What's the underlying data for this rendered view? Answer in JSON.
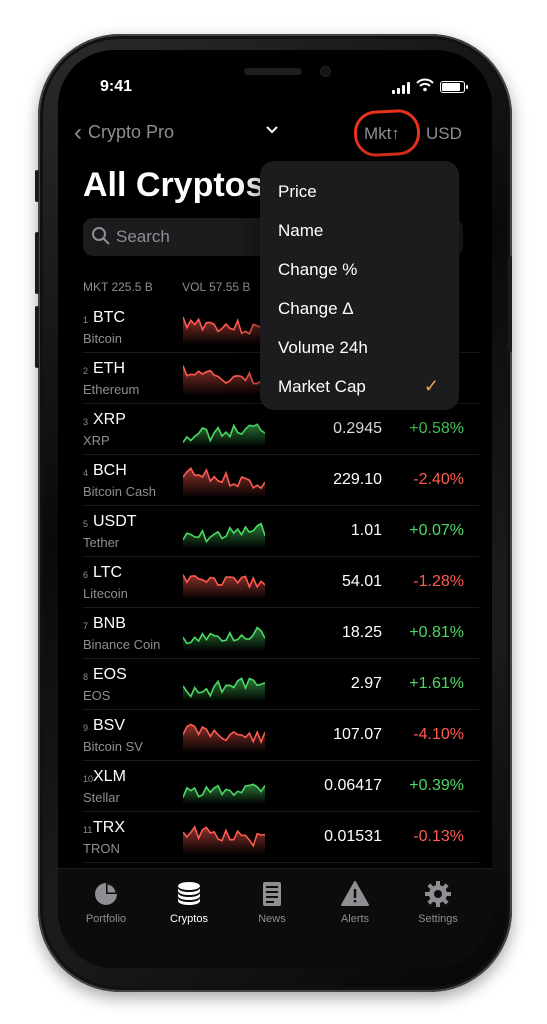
{
  "status": {
    "time": "9:41"
  },
  "nav": {
    "back_label": "Crypto Pro",
    "back_icon": "chevron-left-icon",
    "dropdown_icon": "chevron-down-icon",
    "sort_label": "Mkt↑",
    "currency_label": "USD"
  },
  "page": {
    "title": "All Cryptos"
  },
  "search": {
    "placeholder": "Search"
  },
  "summary": {
    "mkt": "MKT 225.5 B",
    "vol": "VOL 57.55 B"
  },
  "sort_menu": {
    "items": [
      {
        "label": "Price",
        "checked": false
      },
      {
        "label": "Name",
        "checked": false
      },
      {
        "label": "Change %",
        "checked": false
      },
      {
        "label": "Change Δ",
        "checked": false
      },
      {
        "label": "Volume 24h",
        "checked": false
      },
      {
        "label": "Market Cap",
        "checked": true
      }
    ],
    "check_glyph": "✓"
  },
  "coins": [
    {
      "rank": "1",
      "symbol": "BTC",
      "name": "Bitcoin",
      "price": "",
      "change": "",
      "trend": "down"
    },
    {
      "rank": "2",
      "symbol": "ETH",
      "name": "Ethereum",
      "price": "",
      "change": "",
      "trend": "down"
    },
    {
      "rank": "3",
      "symbol": "XRP",
      "name": "XRP",
      "price": "0.2945",
      "change": "+0.58%",
      "trend": "up"
    },
    {
      "rank": "4",
      "symbol": "BCH",
      "name": "Bitcoin Cash",
      "price": "229.10",
      "change": "-2.40%",
      "trend": "down"
    },
    {
      "rank": "5",
      "symbol": "USDT",
      "name": "Tether",
      "price": "1.01",
      "change": "+0.07%",
      "trend": "up"
    },
    {
      "rank": "6",
      "symbol": "LTC",
      "name": "Litecoin",
      "price": "54.01",
      "change": "-1.28%",
      "trend": "down"
    },
    {
      "rank": "7",
      "symbol": "BNB",
      "name": "Binance Coin",
      "price": "18.25",
      "change": "+0.81%",
      "trend": "up"
    },
    {
      "rank": "8",
      "symbol": "EOS",
      "name": "EOS",
      "price": "2.97",
      "change": "+1.61%",
      "trend": "up"
    },
    {
      "rank": "9",
      "symbol": "BSV",
      "name": "Bitcoin SV",
      "price": "107.07",
      "change": "-4.10%",
      "trend": "down"
    },
    {
      "rank": "10",
      "symbol": "XLM",
      "name": "Stellar",
      "price": "0.06417",
      "change": "+0.39%",
      "trend": "up"
    },
    {
      "rank": "11",
      "symbol": "TRX",
      "name": "TRON",
      "price": "0.01531",
      "change": "-0.13%",
      "trend": "down"
    }
  ],
  "tabs": [
    {
      "label": "Portfolio",
      "icon": "pie-chart-icon",
      "active": false
    },
    {
      "label": "Cryptos",
      "icon": "coins-stack-icon",
      "active": true
    },
    {
      "label": "News",
      "icon": "newspaper-icon",
      "active": false
    },
    {
      "label": "Alerts",
      "icon": "alert-triangle-icon",
      "active": false
    },
    {
      "label": "Settings",
      "icon": "gear-icon",
      "active": false
    }
  ],
  "colors": {
    "up": "#4cd964",
    "down": "#ff5b4f",
    "accent": "#f0a24e",
    "highlight_ring": "#e8321c"
  }
}
